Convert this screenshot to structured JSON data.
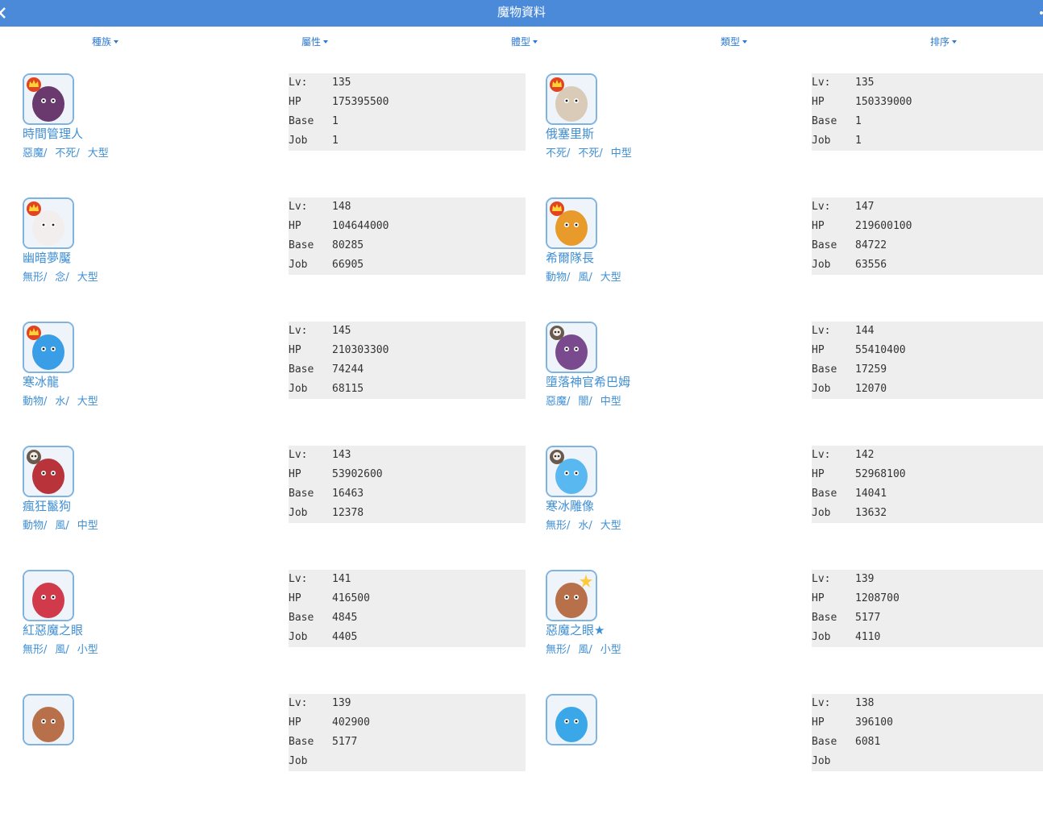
{
  "header": {
    "title": "魔物資料"
  },
  "filters": [
    {
      "label": "種族"
    },
    {
      "label": "屬性"
    },
    {
      "label": "體型"
    },
    {
      "label": "類型"
    },
    {
      "label": "排序"
    }
  ],
  "stat_labels": {
    "lv": "Lv:",
    "hp": "HP",
    "base": "Base",
    "job": "Job"
  },
  "monsters": [
    {
      "name": "時間管理人",
      "tags": [
        "惡魔/",
        "不死/",
        "大型"
      ],
      "lv": "135",
      "hp": "175395500",
      "base": "1",
      "job": "1",
      "avatar_color": "#6a3a6e",
      "badge": "boss-crown-icon"
    },
    {
      "name": "俄塞里斯",
      "tags": [
        "不死/",
        "不死/",
        "中型"
      ],
      "lv": "135",
      "hp": "150339000",
      "base": "1",
      "job": "1",
      "avatar_color": "#d9cbb8",
      "badge": "boss-crown-icon"
    },
    {
      "name": "幽暗夢魘",
      "tags": [
        "無形/",
        "念/",
        "大型"
      ],
      "lv": "148",
      "hp": "104644000",
      "base": "80285",
      "job": "66905",
      "avatar_color": "#f3eeee",
      "badge": "boss-crown-icon"
    },
    {
      "name": "希爾隊長",
      "tags": [
        "動物/",
        "風/",
        "大型"
      ],
      "lv": "147",
      "hp": "219600100",
      "base": "84722",
      "job": "63556",
      "avatar_color": "#e89a2a",
      "badge": "boss-crown-icon"
    },
    {
      "name": "寒冰龍",
      "tags": [
        "動物/",
        "水/",
        "大型"
      ],
      "lv": "145",
      "hp": "210303300",
      "base": "74244",
      "job": "68115",
      "avatar_color": "#3a9ee6",
      "badge": "boss-crown-icon"
    },
    {
      "name": "墮落神官希巴姆",
      "tags": [
        "惡魔/",
        "闇/",
        "中型"
      ],
      "lv": "144",
      "hp": "55410400",
      "base": "17259",
      "job": "12070",
      "avatar_color": "#7a4a8e",
      "badge": "mini-boss-skull-icon"
    },
    {
      "name": "瘋狂鬣狗",
      "tags": [
        "動物/",
        "風/",
        "中型"
      ],
      "lv": "143",
      "hp": "53902600",
      "base": "16463",
      "job": "12378",
      "avatar_color": "#b8343a",
      "badge": "mini-boss-skull-icon"
    },
    {
      "name": "寒冰雕像",
      "tags": [
        "無形/",
        "水/",
        "大型"
      ],
      "lv": "142",
      "hp": "52968100",
      "base": "14041",
      "job": "13632",
      "avatar_color": "#5ab8f0",
      "badge": "mini-boss-skull-icon"
    },
    {
      "name": "紅惡魔之眼",
      "tags": [
        "無形/",
        "風/",
        "小型"
      ],
      "lv": "141",
      "hp": "416500",
      "base": "4845",
      "job": "4405",
      "avatar_color": "#d03a4a",
      "badge": ""
    },
    {
      "name": "惡魔之眼★",
      "tags": [
        "無形/",
        "風/",
        "小型"
      ],
      "lv": "139",
      "hp": "1208700",
      "base": "5177",
      "job": "4110",
      "avatar_color": "#b8704a",
      "badge": "star-icon"
    },
    {
      "name": "",
      "tags": [],
      "lv": "139",
      "hp": "402900",
      "base": "5177",
      "job": "",
      "avatar_color": "#b8704a",
      "badge": ""
    },
    {
      "name": "",
      "tags": [],
      "lv": "138",
      "hp": "396100",
      "base": "6081",
      "job": "",
      "avatar_color": "#3aa8e8",
      "badge": ""
    }
  ]
}
